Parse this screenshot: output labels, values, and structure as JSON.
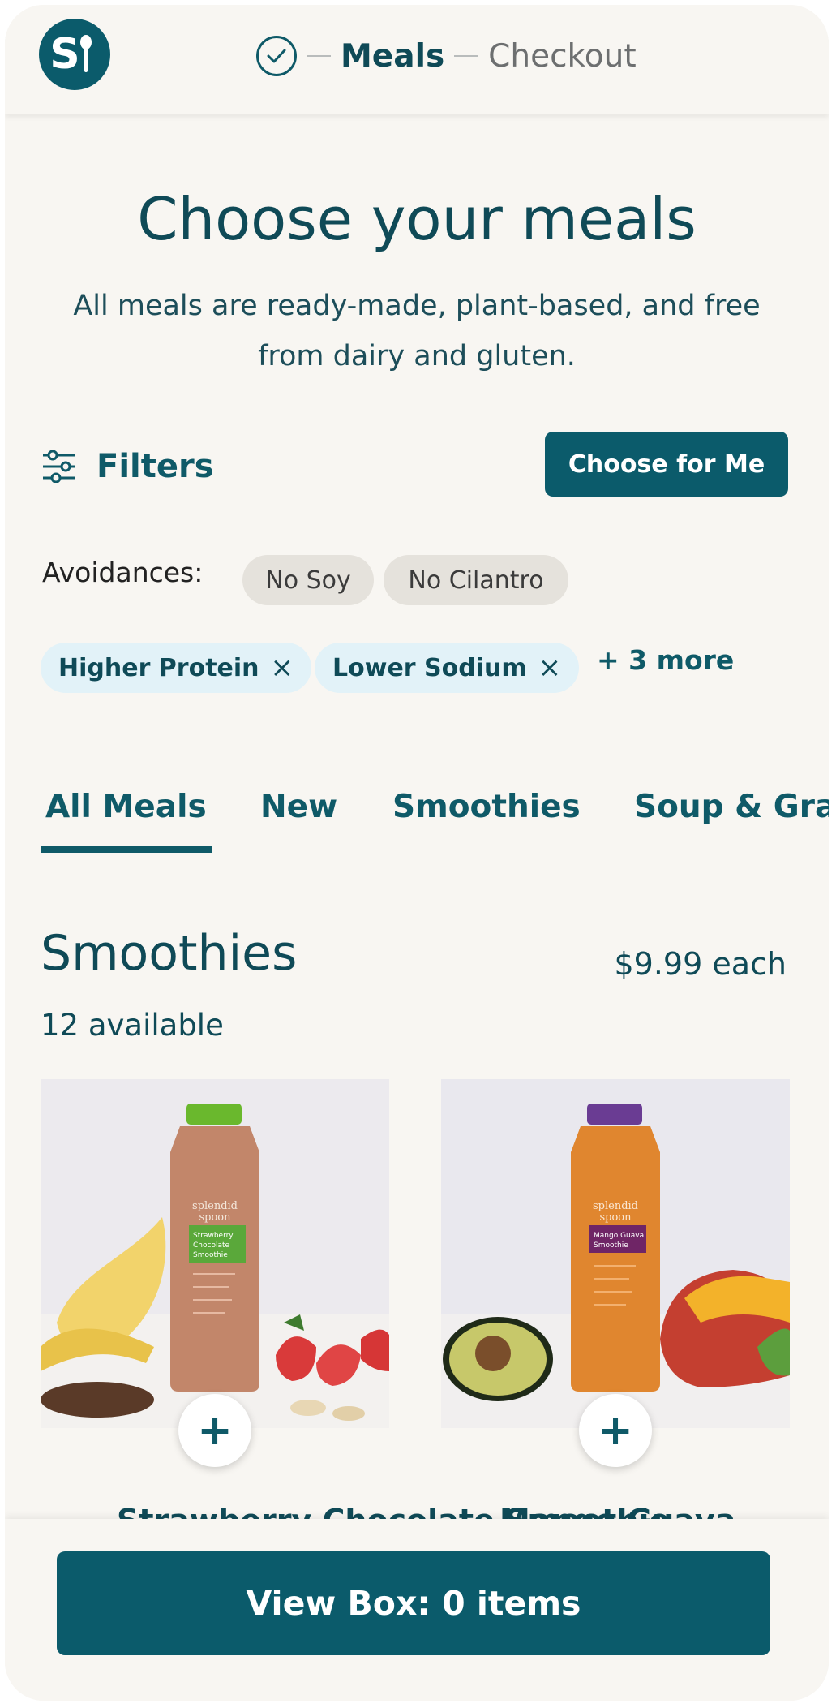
{
  "header": {
    "logo_letter": "S",
    "steps": {
      "meals": "Meals",
      "checkout": "Checkout"
    }
  },
  "page": {
    "title": "Choose your meals",
    "subtitle": "All meals are ready-made, plant-based, and free from dairy and gluten."
  },
  "filters": {
    "label": "Filters",
    "choose_button": "Choose for Me",
    "avoidances_label": "Avoidances:",
    "avoidances": [
      "No Soy",
      "No Cilantro"
    ],
    "active": [
      "Higher Protein",
      "Lower Sodium"
    ],
    "remove_icon": "×",
    "more": "+ 3 more"
  },
  "tabs": [
    "All Meals",
    "New",
    "Smoothies",
    "Soup & Gra"
  ],
  "section": {
    "title": "Smoothies",
    "price": "$9.99 each",
    "count": "12 available"
  },
  "products": [
    {
      "name": "Strawberry Chocolate Smoothie",
      "cap_color": "#6ab82d",
      "label_color": "#5aa83a",
      "label_lines": [
        "Strawberry",
        "Chocolate",
        "Smoothie"
      ],
      "brand": "splendid spoon"
    },
    {
      "name": "Mango Guava Smoothie",
      "cap_color": "#6a3c93",
      "label_color": "#6f2566",
      "label_lines": [
        "Mango Guava",
        "Smoothie"
      ],
      "brand": "splendid spoon"
    }
  ],
  "add_icon": "+",
  "bottom": {
    "view_box": "View Box: 0 items"
  },
  "colors": {
    "primary": "#0b5b6b",
    "background": "#f8f6f2",
    "chip_blue": "#e2f2f8",
    "chip_gray": "#e5e2dc"
  }
}
